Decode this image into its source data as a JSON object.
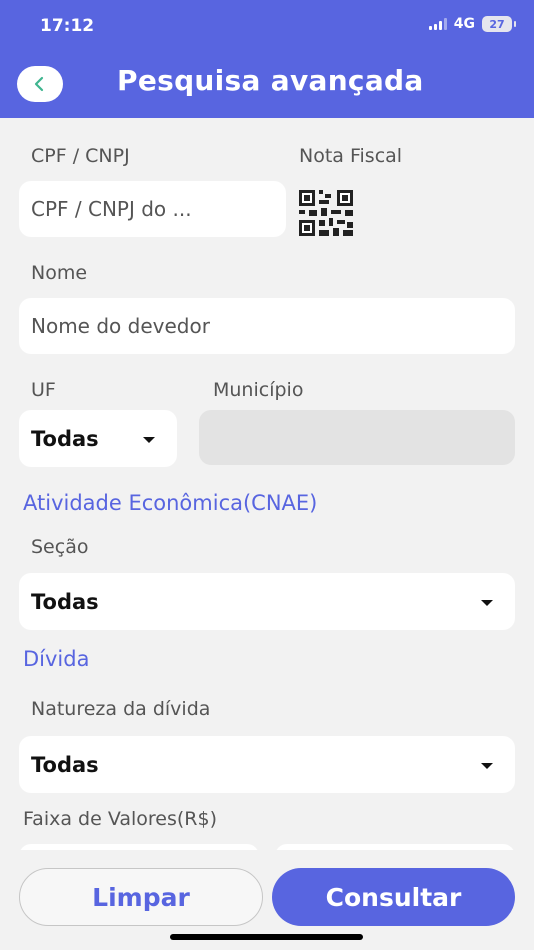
{
  "status_bar": {
    "time": "17:12",
    "network": "4G",
    "battery": "27"
  },
  "header": {
    "title": "Pesquisa avançada"
  },
  "form": {
    "cpf_label": "CPF / CNPJ",
    "cpf_placeholder": "CPF / CNPJ do ...",
    "nota_fiscal_label": "Nota Fiscal",
    "nome_label": "Nome",
    "nome_placeholder": "Nome do devedor",
    "uf_label": "UF",
    "uf_value": "Todas",
    "municipio_label": "Município",
    "municipio_value": "",
    "cnae_section": "Atividade Econômica(CNAE)",
    "secao_label": "Seção",
    "secao_value": "Todas",
    "divida_section": "Dívida",
    "natureza_label": "Natureza da dívida",
    "natureza_value": "Todas",
    "faixa_label": "Faixa de Valores(R$)"
  },
  "actions": {
    "clear_label": "Limpar",
    "search_label": "Consultar"
  },
  "icons": {
    "back": "chevron-left-icon",
    "qr": "qr-code-icon",
    "caret": "caret-down-icon"
  },
  "colors": {
    "accent": "#5865e0",
    "background": "#f2f2f2"
  }
}
